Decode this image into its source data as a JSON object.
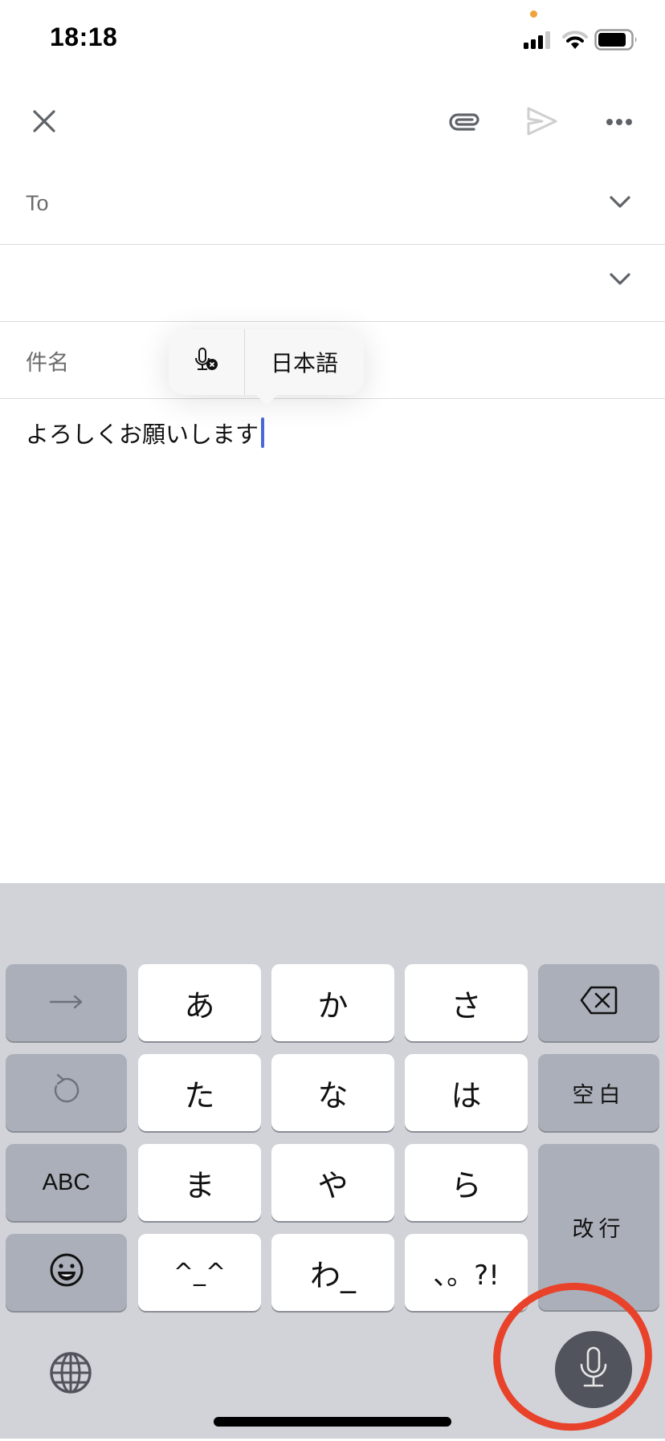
{
  "status_bar": {
    "time": "18:18",
    "indicator_color": "#f0a23a",
    "signal": "signal-icon",
    "wifi": "wifi-icon",
    "battery": "battery-icon"
  },
  "toolbar": {
    "close": "close-icon",
    "attach": "paperclip-icon",
    "send": "send-icon",
    "more": "more-icon"
  },
  "compose": {
    "to_label": "To",
    "subject_label": "件名",
    "body": "よろしくお願いします"
  },
  "dictation_popover": {
    "stop_icon": "mic-cancel-icon",
    "language": "日本語"
  },
  "keyboard": {
    "rows": [
      [
        "→",
        "あ",
        "か",
        "さ",
        "⌫"
      ],
      [
        "↺",
        "た",
        "な",
        "は",
        "空白"
      ],
      [
        "ABC",
        "ま",
        "や",
        "ら",
        "改行"
      ],
      [
        "☺",
        "^_^",
        "わ_",
        "、。?!"
      ]
    ],
    "keys": {
      "next": "→",
      "a": "あ",
      "ka": "か",
      "sa": "さ",
      "undo": "undo-icon",
      "ta": "た",
      "na": "な",
      "ha": "は",
      "space": "空白",
      "abc": "ABC",
      "ma": "ま",
      "ya": "や",
      "ra": "ら",
      "return": "改行",
      "emoji": "emoji-icon",
      "kaomoji": "^_^",
      "wa": "わ_",
      "punct": "、。?!"
    },
    "globe": "globe-icon",
    "dictation": "microphone-icon",
    "highlight_color": "#e8432a"
  }
}
